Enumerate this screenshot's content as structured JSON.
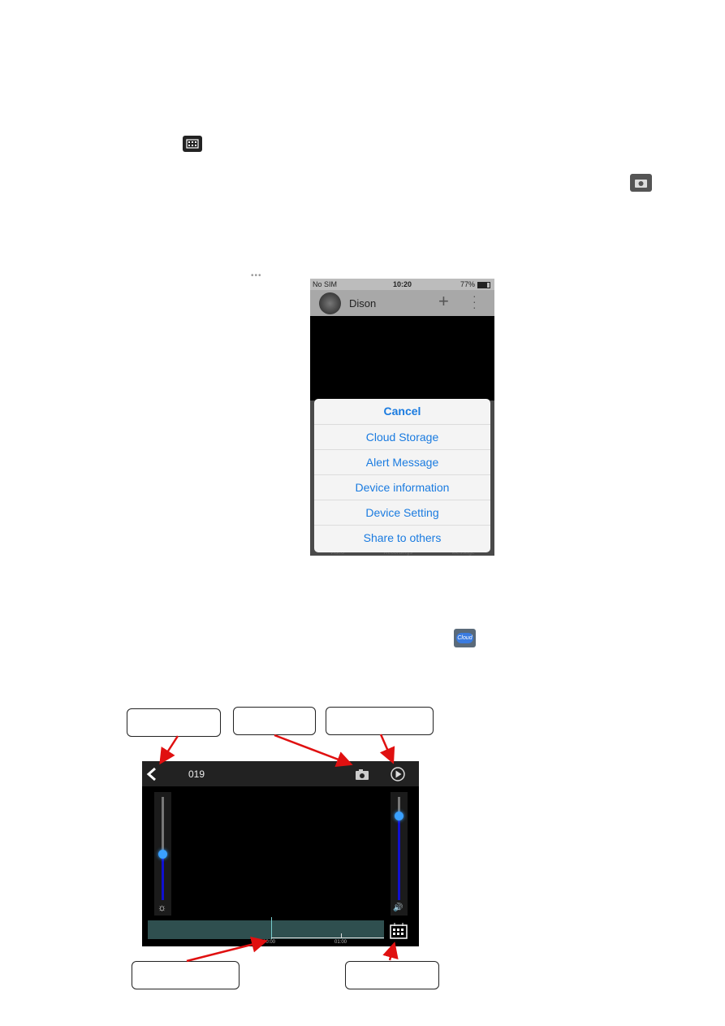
{
  "inline_icons": {
    "calendar": "calendar-icon",
    "camera": "camera-icon",
    "more": "more-dots-icon",
    "cloud": "Cloud"
  },
  "phone": {
    "status": {
      "carrier": "No SIM",
      "time": "10:20",
      "battery": "77%"
    },
    "device_name": "Dison",
    "tabs_behind": [
      "Video",
      "Recordings",
      "Message"
    ],
    "action_sheet": {
      "cancel": "Cancel",
      "items": [
        "Cloud Storage",
        "Alert Message",
        "Device information",
        "Device Setting",
        "Share to others"
      ]
    },
    "accent": "#1a7be0"
  },
  "player": {
    "title": "019",
    "brightness_level": 0.45,
    "volume_level": 0.82,
    "timeline_labels": [
      "00:00",
      "01:00"
    ],
    "timeline_color": "#2f4f4f",
    "slider_color": "#1010d0"
  },
  "annotation_color": "#e01010"
}
